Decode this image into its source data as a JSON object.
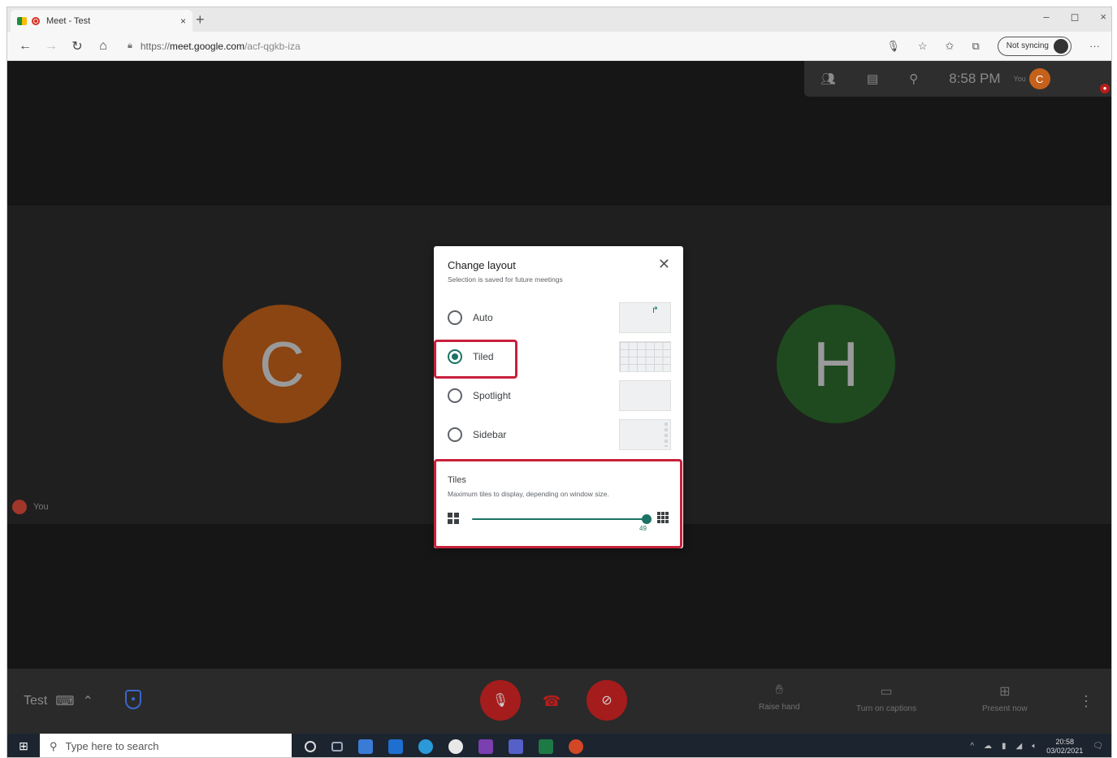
{
  "browser": {
    "tab_title": "Meet - Test",
    "tab_close": "×",
    "new_tab": "+",
    "window_controls": [
      "–",
      "◻",
      "×"
    ],
    "url_scheme": "https://",
    "url_host": "meet.google.com",
    "url_path": "/acf-qgkb-iza",
    "sync_label": "Not syncing",
    "more_label": "···"
  },
  "meet": {
    "clock": "8:58 PM",
    "you_top_label": "You",
    "me_initial": "C",
    "participants": [
      {
        "initial": "C",
        "color": "#8a4512"
      },
      {
        "initial": "H",
        "color": "#1f4a1f"
      }
    ],
    "you_tag": "You"
  },
  "dialog": {
    "title": "Change layout",
    "subtitle": "Selection is saved for future meetings",
    "close": "✕",
    "options": [
      {
        "label": "Auto",
        "selected": false
      },
      {
        "label": "Tiled",
        "selected": true
      },
      {
        "label": "Spotlight",
        "selected": false
      },
      {
        "label": "Sidebar",
        "selected": false
      }
    ],
    "tiles_title": "Tiles",
    "tiles_subtitle": "Maximum tiles to display, depending on window size.",
    "tiles_value": "49",
    "tiles_fraction": 1.0,
    "accent": "#1a7364",
    "highlight_color": "#c8203a"
  },
  "meetbar": {
    "meeting_name": "Test",
    "raise_hand": "Raise hand",
    "captions": "Turn on captions",
    "present": "Present now",
    "more": "⋮"
  },
  "taskbar": {
    "search_placeholder": "Type here to search",
    "time": "20:58",
    "date": "03/02/2021"
  }
}
